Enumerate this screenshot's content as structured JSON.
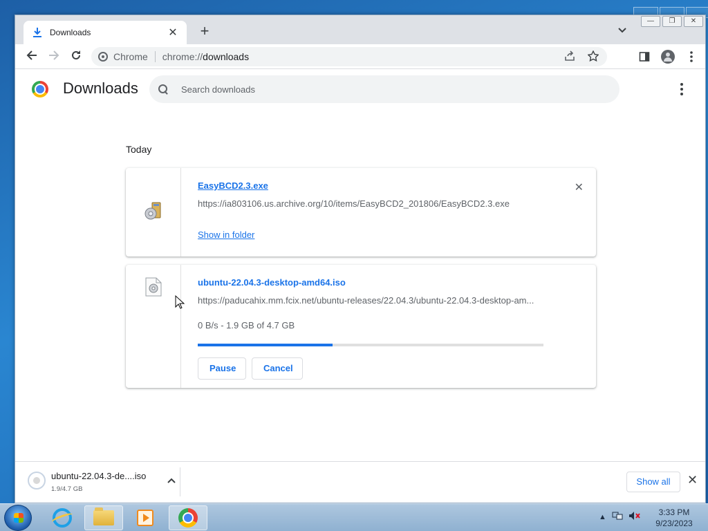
{
  "browser": {
    "tab_title": "Downloads",
    "tab_close": "✕",
    "new_tab": "+",
    "site_chip": "Chrome",
    "url_scheme": "chrome://",
    "url_path": "downloads"
  },
  "page": {
    "title": "Downloads",
    "search_placeholder": "Search downloads",
    "date_header": "Today"
  },
  "downloads": [
    {
      "name": "EasyBCD2.3.exe",
      "url": "https://ia803106.us.archive.org/10/items/EasyBCD2_201806/EasyBCD2.3.exe",
      "action_link": "Show in folder",
      "remove": "✕"
    },
    {
      "name": "ubuntu-22.04.3-desktop-amd64.iso",
      "url": "https://paducahix.mm.fcix.net/ubuntu-releases/22.04.3/ubuntu-22.04.3-desktop-am...",
      "status": "0 B/s - 1.9 GB of 4.7 GB",
      "progress_fraction": 0.39,
      "pause_label": "Pause",
      "cancel_label": "Cancel"
    }
  ],
  "shelf": {
    "item_name": "ubuntu-22.04.3-de....iso",
    "item_size": "1.9/4.7 GB",
    "show_all": "Show all",
    "close": "✕"
  },
  "taskbar": {
    "time": "3:33 PM",
    "date": "9/23/2023"
  },
  "colors": {
    "accent": "#1a73e8",
    "desktop": "#1f6fb8"
  }
}
